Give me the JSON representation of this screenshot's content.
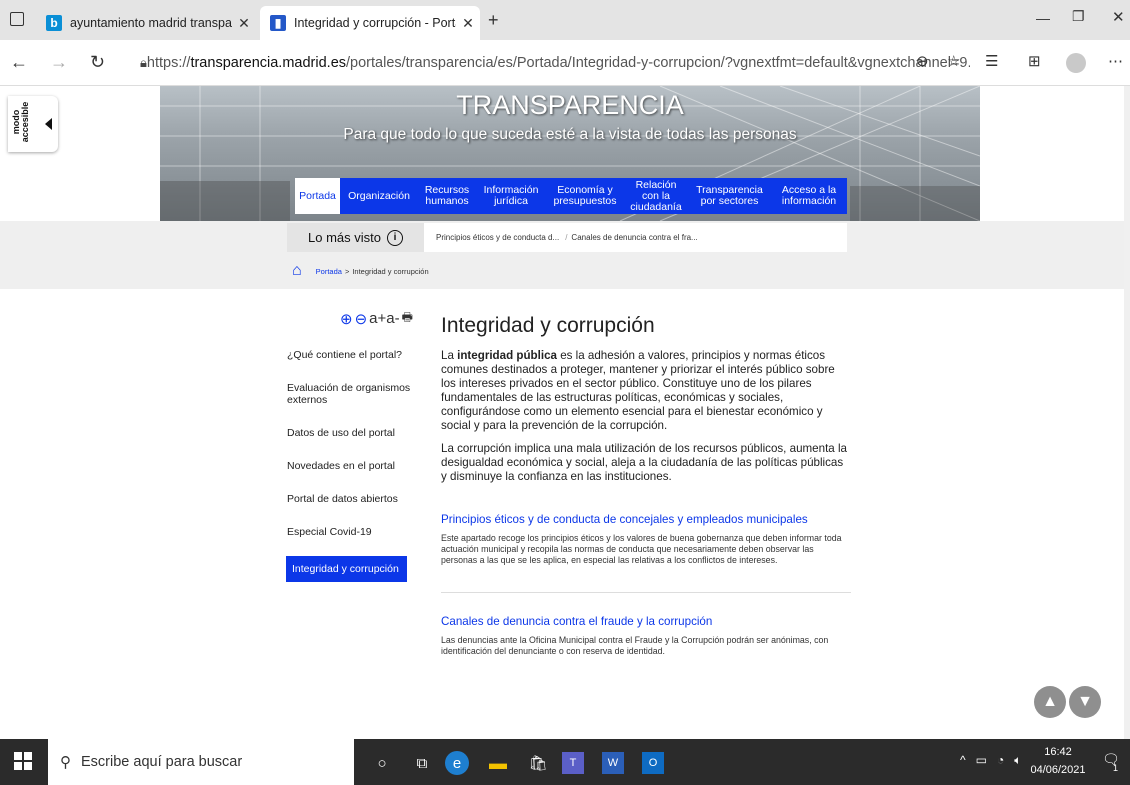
{
  "browser": {
    "tabs": [
      {
        "title": "ayuntamiento madrid transparen",
        "favicon": "bing-icon",
        "active": false
      },
      {
        "title": "Integridad y corrupción - Portal c",
        "favicon": "madrid-portal-icon",
        "active": true
      }
    ],
    "new_tab": "+",
    "url_prefix": "https://",
    "url_host": "transparencia.madrid.es",
    "url_path": "/portales/transparencia/es/Portada/Integridad-y-corrupcion/?vgnextfmt=default&vgnextchannel=9..."
  },
  "site": {
    "hero_title": "TRANSPARENCIA",
    "hero_subtitle": "Para que todo lo que suceda esté a la vista de todas las personas",
    "accessible_mode": "modo accesible",
    "nav": [
      {
        "label": "Portada",
        "active": true
      },
      {
        "label": "Organización",
        "active": false
      },
      {
        "label": "Recursos humanos",
        "active": false
      },
      {
        "label": "Información jurídica",
        "active": false
      },
      {
        "label": "Economía y presupuestos",
        "active": false
      },
      {
        "label": "Relación con la ciudadanía",
        "active": false
      },
      {
        "label": "Transparencia por sectores",
        "active": false
      },
      {
        "label": "Acceso a la información",
        "active": false
      }
    ],
    "mas_visto": {
      "label": "Lo más visto",
      "links": [
        "Principios éticos y de conducta d...",
        "Canales de denuncia contra el fra..."
      ]
    },
    "breadcrumb": {
      "home": "Portada",
      "separator": ">",
      "current": "Integridad y corrupción"
    },
    "tools": {
      "zoom_in": "⊕",
      "zoom_out": "⊖",
      "text_size": "a+a-",
      "print": "🖶"
    }
  },
  "sidebar": {
    "items": [
      {
        "label": "¿Qué contiene el portal?",
        "active": false
      },
      {
        "label": "Evaluación de organismos externos",
        "active": false
      },
      {
        "label": "Datos de uso del portal",
        "active": false
      },
      {
        "label": "Novedades en el portal",
        "active": false
      },
      {
        "label": "Portal de datos abiertos",
        "active": false
      },
      {
        "label": "Especial Covid-19",
        "active": false
      },
      {
        "label": "Integridad y corrupción",
        "active": true
      }
    ]
  },
  "content": {
    "title": "Integridad y corrupción",
    "intro_1_pre": "La ",
    "intro_1_bold": "integridad pública",
    "intro_1_post": " es  la adhesión a valores, principios y normas éticos comunes destinados a proteger,  mantener y priorizar el interés público sobre los intereses privados en el sector público. Constituye uno de los pilares fundamentales de las estructuras políticas, económicas y sociales, configurándose como un elemento esencial para el bienestar económico y social y para la prevención de la corrupción.",
    "intro_2": "La corrupción implica una mala utilización de  los recursos públicos, aumenta la desigualdad económica y social, aleja a la ciudadanía de las  políticas públicas y disminuye la confianza en las instituciones.",
    "sections": [
      {
        "title": "Principios éticos y de conducta de concejales y empleados municipales",
        "text": "Este apartado recoge los principios éticos y los valores de buena gobernanza que deben informar toda actuación municipal y recopila las normas de conducta que necesariamente deben observar las personas a las que se les aplica, en especial las relativas a los conflictos de intereses."
      },
      {
        "title": "Canales de denuncia contra el fraude y la corrupción",
        "text": "Las denuncias ante la Oficina Municipal contra el Fraude y la Corrupción podrán ser anónimas, con identificación del denunciante o con reserva de identidad."
      }
    ]
  },
  "taskbar": {
    "search_placeholder": "Escribe aquí para buscar",
    "time": "16:42",
    "date": "04/06/2021",
    "notification_count": "1"
  },
  "colors": {
    "brand_blue": "#0c37e8",
    "taskbar": "#2b2b2b"
  }
}
